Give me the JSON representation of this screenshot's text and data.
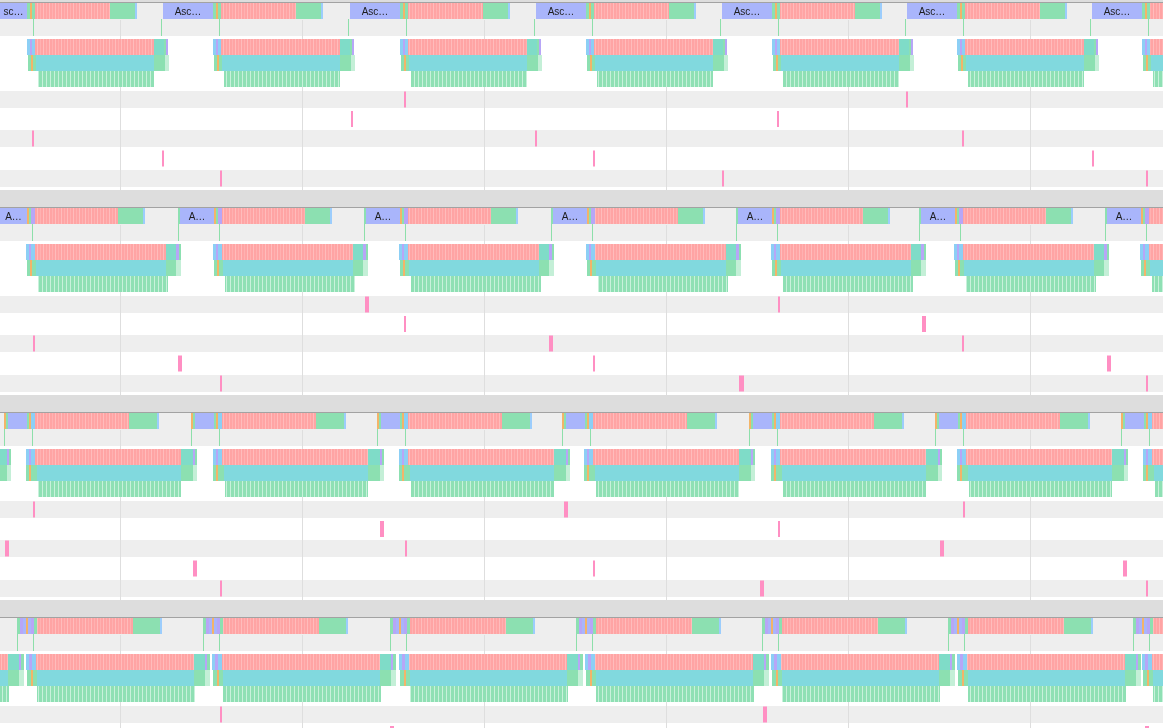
{
  "tracks": [
    {
      "task_labels": [
        "sc…",
        "Asc…",
        "Asc…",
        "Asc…",
        "Asc…",
        "Asc…",
        "Asc…"
      ]
    },
    {
      "task_labels": [
        "A…",
        "A…",
        "A…",
        "A…",
        "A…",
        "A…",
        "A…"
      ]
    }
  ]
}
